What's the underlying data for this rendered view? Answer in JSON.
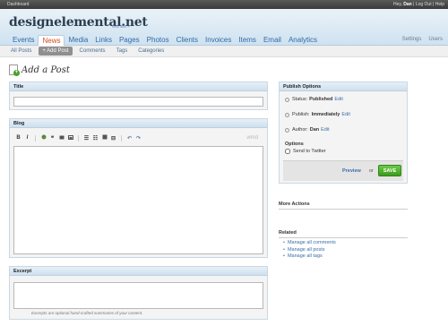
{
  "topbar": {
    "dashboard": "Dashboard",
    "greeting": "Hey,",
    "user": "Dan",
    "logout": "Log Out",
    "help": "Help",
    "sep": "|"
  },
  "site": {
    "title": "designelemental.net",
    "visit_link": "visit site »"
  },
  "nav": {
    "items": [
      "Events",
      "News",
      "Media",
      "Links",
      "Pages",
      "Photos",
      "Clients",
      "Invoices",
      "Items",
      "Email",
      "Analytics"
    ],
    "active": "News",
    "right": [
      "Settings",
      "Users"
    ]
  },
  "subnav": {
    "items": [
      "All Posts",
      "+ Add Post",
      "Comments",
      "Tags",
      "Categories"
    ]
  },
  "page": {
    "title": "Add a Post"
  },
  "title_box": {
    "label": "Title",
    "value": ""
  },
  "blog_box": {
    "label": "Blog",
    "toolbar": [
      "B",
      "I",
      "link",
      "quote",
      "code",
      "image",
      "ol",
      "ul",
      "heading",
      "hr",
      "undo",
      "redo"
    ],
    "wmd_label": "wmd",
    "value": ""
  },
  "excerpt_box": {
    "label": "Excerpt",
    "value": "",
    "caption": "Excerpts are optional hand-crafted summaries of your content."
  },
  "publish": {
    "title": "Publish Options",
    "status_label": "Status:",
    "status_value": "Published",
    "publish_label": "Publish:",
    "publish_value": "Immediately",
    "author_label": "Author:",
    "author_value": "Dan",
    "edit": "Edit",
    "options_label": "Options",
    "twitter_label": "Send to Twitter",
    "twitter_checked": false,
    "preview": "Preview",
    "or": "or",
    "save": "SAVE",
    "save_color": "#4aa02c"
  },
  "more_actions": {
    "title": "More Actions"
  },
  "related": {
    "title": "Related",
    "links": [
      "Manage all comments",
      "Manage all posts",
      "Manage all tags"
    ]
  }
}
